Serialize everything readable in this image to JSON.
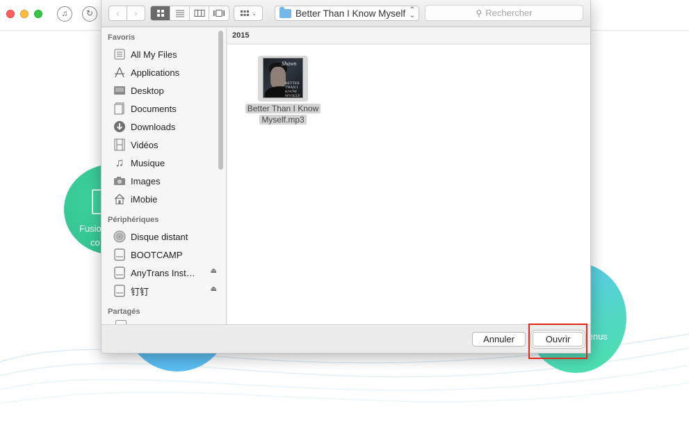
{
  "app": {
    "bg_left_circle_lines": [
      "Fusio",
      "co"
    ],
    "bg_right_circle_text": "tenus"
  },
  "dialog": {
    "toolbar": {
      "path_folder": "Better Than I Know Myself",
      "search_placeholder": "Rechercher"
    },
    "sidebar": {
      "sections": [
        {
          "heading": "Favoris",
          "items": [
            {
              "label": "All My Files",
              "icon": "all-files-icon"
            },
            {
              "label": "Applications",
              "icon": "applications-icon"
            },
            {
              "label": "Desktop",
              "icon": "desktop-icon"
            },
            {
              "label": "Documents",
              "icon": "documents-icon"
            },
            {
              "label": "Downloads",
              "icon": "downloads-icon"
            },
            {
              "label": "Vidéos",
              "icon": "videos-icon"
            },
            {
              "label": "Musique",
              "icon": "music-icon"
            },
            {
              "label": "Images",
              "icon": "camera-icon"
            },
            {
              "label": "iMobie",
              "icon": "home-icon"
            }
          ]
        },
        {
          "heading": "Périphériques",
          "items": [
            {
              "label": "Disque distant",
              "icon": "optical-disc-icon"
            },
            {
              "label": "BOOTCAMP",
              "icon": "drive-icon"
            },
            {
              "label": "AnyTrans Inst…",
              "icon": "drive-icon",
              "eject": true
            },
            {
              "label": "钉钉",
              "icon": "drive-icon",
              "eject": true
            }
          ]
        },
        {
          "heading": "Partagés",
          "items": []
        }
      ]
    },
    "content": {
      "column_header": "2015",
      "files": [
        {
          "name_line1": "Better Than I Know",
          "name_line2": "Myself.mp3",
          "selected": true
        }
      ],
      "album_cover_text": "BETTER THAN I KNOW MYSELF"
    },
    "footer": {
      "cancel_label": "Annuler",
      "open_label": "Ouvrir"
    }
  },
  "colors": {
    "highlight_box": "#e3281a",
    "folder_blue": "#74b7ea",
    "selected_view_segment": "#6a6a6a"
  }
}
